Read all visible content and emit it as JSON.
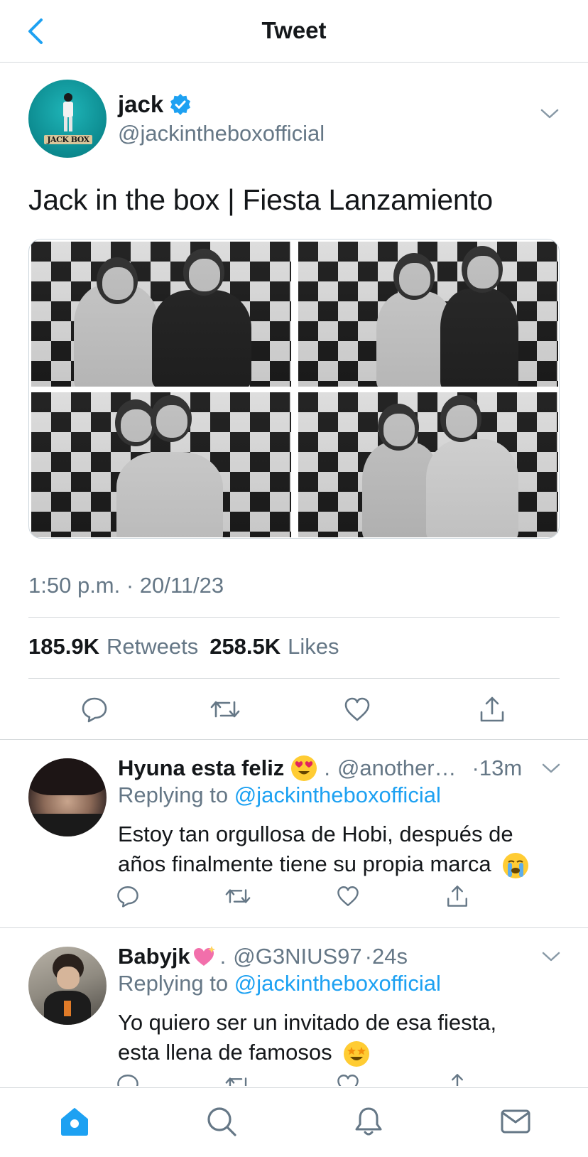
{
  "header": {
    "title": "Tweet"
  },
  "tweet": {
    "author_name": "jack",
    "author_handle": "@jackintheboxofficial",
    "avatar_logo": "JACK BOX",
    "text": "Jack in the box | Fiesta Lanzamiento",
    "timestamp": "1:50 p.m. · 20/11/23",
    "retweets_count": "185.9K",
    "retweets_label": "Retweets",
    "likes_count": "258.5K",
    "likes_label": "Likes",
    "media_count": 4
  },
  "replies": [
    {
      "name": "Hyuna esta feliz",
      "name_emoji": "heart-eyes-emoji",
      "handle": "@another…",
      "time": "·13m",
      "replying_prefix": "Replying to",
      "replying_to": "@jackintheboxofficial",
      "text": "Estoy tan orgullosa de Hobi, después de años finalmente tiene su propia marca",
      "text_emoji": "crying-emoji"
    },
    {
      "name": "Babyjk",
      "name_emoji": "sparkling-heart-emoji",
      "handle": "@G3NIUS97",
      "time": "·24s",
      "replying_prefix": "Replying to",
      "replying_to": "@jackintheboxofficial",
      "text": "Yo quiero ser un invitado de esa fiesta, esta llena de famosos",
      "text_emoji": "star-struck-emoji"
    }
  ],
  "tabbar": [
    "home-icon",
    "search-icon",
    "notifications-icon",
    "messages-icon"
  ],
  "colors": {
    "accent": "#1da1f2",
    "secondary_text": "#657786",
    "primary_text": "#14171a",
    "divider": "#d5d9dc"
  }
}
